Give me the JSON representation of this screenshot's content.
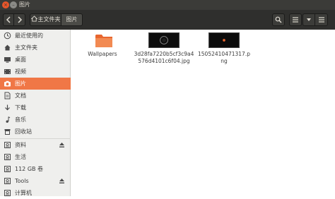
{
  "window": {
    "title": "图片",
    "close_glyph": "×",
    "minimize_glyph": "–"
  },
  "toolbar": {
    "back_icon": "chevron-left-icon",
    "forward_icon": "chevron-right-icon",
    "path": [
      {
        "label": "主文件夹",
        "icon": "home-icon"
      },
      {
        "label": "图片"
      }
    ],
    "right_icons": [
      "search-icon",
      "list-view-icon",
      "menu-icon",
      "more-icon"
    ]
  },
  "sidebar": {
    "items": [
      {
        "label": "最近使用的",
        "icon": "clock-icon"
      },
      {
        "label": "主文件夹",
        "icon": "home-icon"
      },
      {
        "label": "桌面",
        "icon": "desktop-icon"
      },
      {
        "label": "视频",
        "icon": "video-icon"
      },
      {
        "label": "图片",
        "icon": "camera-icon",
        "active": true
      },
      {
        "label": "文档",
        "icon": "document-icon"
      },
      {
        "label": "下载",
        "icon": "download-icon"
      },
      {
        "label": "音乐",
        "icon": "music-icon"
      },
      {
        "label": "回收站",
        "icon": "trash-icon"
      },
      {
        "label": "资料",
        "icon": "drive-icon",
        "eject": true
      },
      {
        "label": "生活",
        "icon": "drive-icon"
      },
      {
        "label": "112 GB 卷",
        "icon": "drive-icon"
      },
      {
        "label": "Tools",
        "icon": "drive-icon",
        "eject": true
      },
      {
        "label": "计算机",
        "icon": "drive-icon"
      }
    ]
  },
  "files": [
    {
      "name": "Wallpapers",
      "type": "folder"
    },
    {
      "name": "3d28fa7220b5cf3c9a4576d4101c6f04.jpg",
      "type": "image"
    },
    {
      "name": "15052410471317.png",
      "type": "image"
    }
  ],
  "colors": {
    "accent": "#f07746",
    "titlebar": "#3b3b38",
    "toolbar": "#2f2f2d",
    "folder": "#f07746"
  }
}
